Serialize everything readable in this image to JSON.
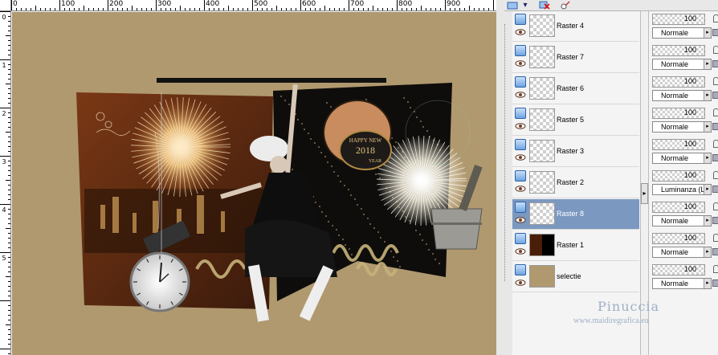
{
  "rulers": {
    "top": [
      "0",
      "100",
      "200",
      "300",
      "400",
      "500",
      "600",
      "700",
      "800",
      "900"
    ],
    "left": [
      "0",
      "1",
      "2",
      "3",
      "4",
      "5"
    ]
  },
  "canvas": {
    "background": "#b0996f",
    "artwork_text": {
      "happy_new": "HAPPY NEW",
      "year_number": "2018",
      "year": "YEAR"
    }
  },
  "toolbar": {
    "icons": [
      "layer-style-icon",
      "delete-layer-icon",
      "mask-brush-icon"
    ]
  },
  "layers": [
    {
      "name": "Raster 4",
      "opacity": "100",
      "blend": "Normale",
      "selected": false
    },
    {
      "name": "Raster 7",
      "opacity": "100",
      "blend": "Normale",
      "selected": false
    },
    {
      "name": "Raster 6",
      "opacity": "100",
      "blend": "Normale",
      "selected": false
    },
    {
      "name": "Raster 5",
      "opacity": "100",
      "blend": "Normale",
      "selected": false
    },
    {
      "name": "Raster 3",
      "opacity": "100",
      "blend": "Normale",
      "selected": false
    },
    {
      "name": "Raster 2",
      "opacity": "100",
      "blend": "Luminanza (L)",
      "selected": false
    },
    {
      "name": "Raster 8",
      "opacity": "100",
      "blend": "Normale",
      "selected": true
    },
    {
      "name": "Raster 1",
      "opacity": "100",
      "blend": "Normale",
      "selected": false
    },
    {
      "name": "selectie",
      "opacity": "100",
      "blend": "Normale",
      "selected": false
    }
  ],
  "watermark": {
    "name": "Pinuccia",
    "url": "www.maidiregrafica.eu"
  },
  "colors": {
    "selected_row": "#7b98c0",
    "watermark": "#9eb0c8"
  }
}
